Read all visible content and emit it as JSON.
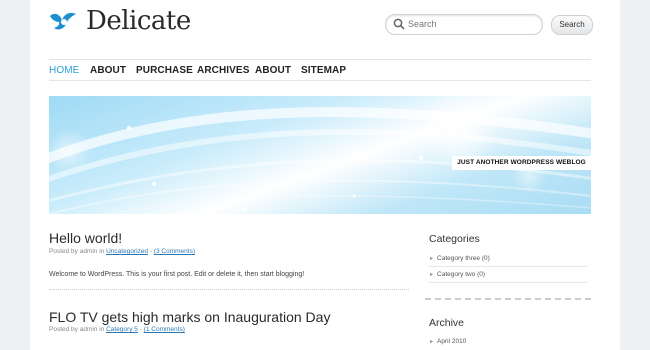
{
  "header": {
    "logo_text": "Delicate",
    "search": {
      "placeholder": "Search",
      "button_label": "Search"
    }
  },
  "nav": {
    "items": [
      {
        "label": "HOME",
        "active": true
      },
      {
        "label": "ABOUT"
      },
      {
        "label": "PURCHASE"
      },
      {
        "label": "ARCHIVES"
      },
      {
        "label": "ABOUT"
      },
      {
        "label": "SITEMAP"
      }
    ]
  },
  "banner": {
    "tagline": "JUST ANOTHER WORDPRESS WEBLOG"
  },
  "posts": [
    {
      "title": "Hello world!",
      "meta_prefix": "Posted by admin in",
      "category": "Uncategorized",
      "comments": "(3 Comments)",
      "excerpt": "Welcome to WordPress. This is your first post. Edit or delete it, then start blogging!"
    },
    {
      "title": "FLO TV gets high marks on Inauguration Day",
      "meta_prefix": "Posted by admin in",
      "category": "Category 5",
      "comments": "(1 Comments)"
    }
  ],
  "sidebar": {
    "categories": {
      "heading": "Categories",
      "items": [
        "Category three (0)",
        "Category two (0)"
      ]
    },
    "archive": {
      "heading": "Archive",
      "items": [
        "April 2010"
      ]
    }
  },
  "colors": {
    "accent": "#2a9fd6",
    "link": "#2a77b5",
    "text": "#2a2a2a"
  }
}
